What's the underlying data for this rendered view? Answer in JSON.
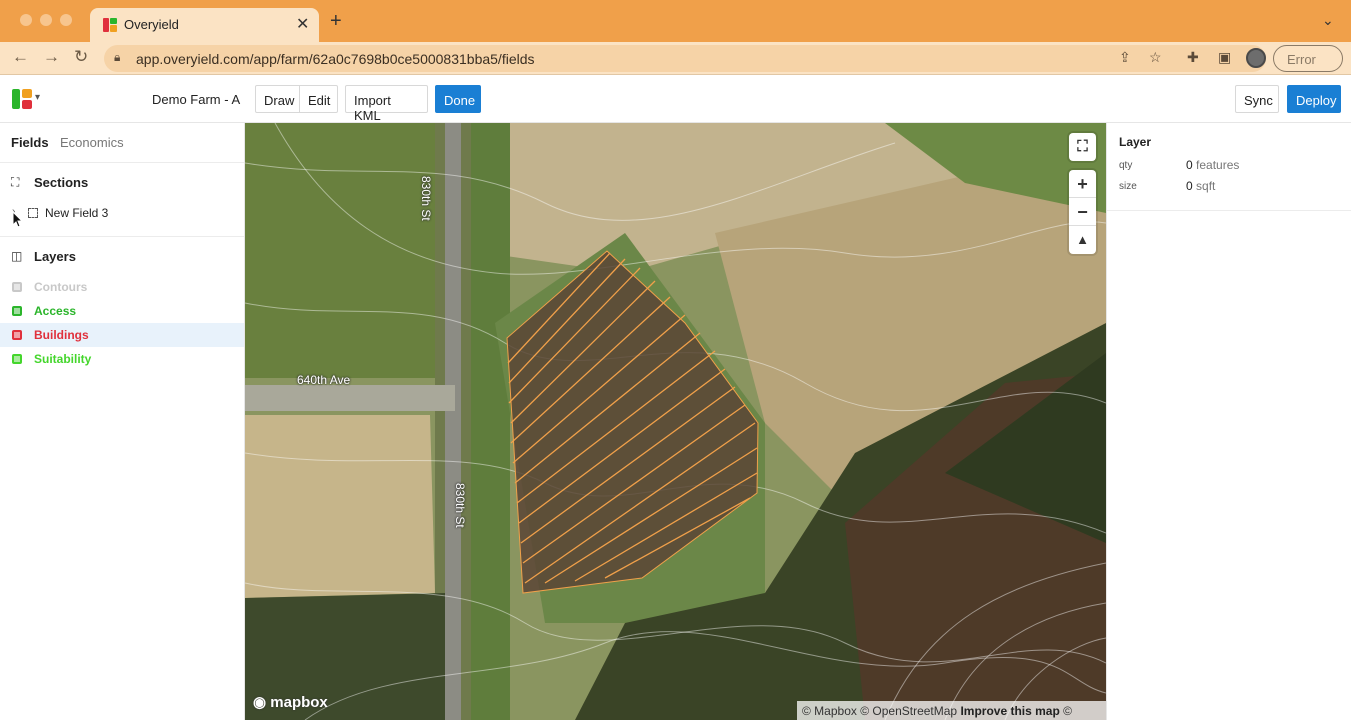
{
  "browser": {
    "tab_title": "Overyield",
    "url": "app.overyield.com/app/farm/62a0c7698b0ce5000831bba5/fields",
    "profile_status": "Error"
  },
  "header": {
    "farm_name": "Demo Farm - A",
    "buttons": {
      "draw": "Draw",
      "edit": "Edit",
      "import_kml": "Import KML",
      "done": "Done",
      "sync": "Sync",
      "deploy": "Deploy"
    },
    "accent_color": "#1a7fd4"
  },
  "sidebar": {
    "tabs": [
      {
        "label": "Fields",
        "active": true
      },
      {
        "label": "Economics",
        "active": false
      }
    ],
    "sections_heading": "Sections",
    "fields": [
      {
        "label": "New Field 3"
      }
    ],
    "layers_heading": "Layers",
    "layers": [
      {
        "label": "Contours",
        "color": "#c8c8c8"
      },
      {
        "label": "Access",
        "color": "#2bb52b"
      },
      {
        "label": "Buildings",
        "color": "#e0303c",
        "highlighted": true
      },
      {
        "label": "Suitability",
        "color": "#44d62c"
      }
    ]
  },
  "map": {
    "road_labels": {
      "north": "830th St",
      "south": "830th St",
      "avenue": "640th Ave"
    },
    "logo": "mapbox",
    "attribution": {
      "mapbox": "© Mapbox",
      "osm": "© OpenStreetMap",
      "improve": "Improve this map",
      "maxar": "© Maxar"
    },
    "controls": {
      "fullscreen": "fullscreen-icon",
      "zoom_in": "+",
      "zoom_out": "−",
      "compass": "compass-icon"
    }
  },
  "layer_panel": {
    "title": "Layer",
    "rows": [
      {
        "key": "qty",
        "value": "0",
        "unit": "features"
      },
      {
        "key": "size",
        "value": "0",
        "unit": "sqft"
      }
    ]
  }
}
